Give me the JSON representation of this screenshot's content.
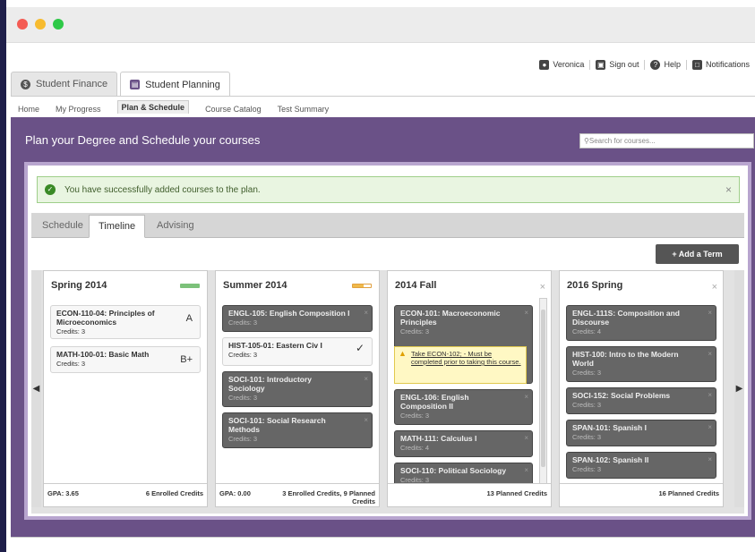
{
  "user": {
    "name": "Veronica",
    "sign_out": "Sign out",
    "help": "Help",
    "notifications": "Notifications"
  },
  "app_tabs": [
    {
      "label": "Student Finance"
    },
    {
      "label": "Student Planning"
    }
  ],
  "subnav": [
    "Home",
    "My Progress",
    "Plan & Schedule",
    "Course Catalog",
    "Test Summary"
  ],
  "header": {
    "title": "Plan your Degree and Schedule your courses",
    "search_placeholder": "Search for courses..."
  },
  "alert": {
    "message": "You have successfully added courses to the plan.",
    "close": "×"
  },
  "view_tabs": [
    "Schedule",
    "Timeline",
    "Advising"
  ],
  "add_term": "+ Add a Term",
  "nav": {
    "prev": "◀",
    "next": "▶"
  },
  "terms": [
    {
      "title": "Spring 2014",
      "courses": [
        {
          "name": "ECON-110-04: Principles of Microeconomics",
          "credits": "Credits: 3",
          "grade": "A"
        },
        {
          "name": "MATH-100-01: Basic Math",
          "credits": "Credits: 3",
          "grade": "B+"
        }
      ],
      "footer_left": "GPA: 3.65",
      "footer_right": "6 Enrolled Credits"
    },
    {
      "title": "Summer 2014",
      "courses": [
        {
          "name": "ENGL-105: English Composition I",
          "credits": "Credits: 3"
        },
        {
          "name": "HIST-105-01: Eastern Civ I",
          "credits": "Credits: 3",
          "mark": "✓"
        },
        {
          "name": "SOCI-101: Introductory Sociology",
          "credits": "Credits: 3"
        },
        {
          "name": "SOCI-101: Social Research Methods",
          "credits": "Credits: 3"
        }
      ],
      "footer_left": "GPA: 0.00",
      "footer_right": "3 Enrolled Credits, 9 Planned Credits"
    },
    {
      "title": "2014 Fall",
      "courses": [
        {
          "name": "ECON-101: Macroeconomic Principles",
          "credits": "Credits: 3"
        },
        {
          "name": "ENGL-106: English Composition II",
          "credits": "Credits: 3"
        },
        {
          "name": "MATH-111: Calculus I",
          "credits": "Credits: 4"
        },
        {
          "name": "SOCI-110: Political Sociology",
          "credits": "Credits: 3"
        }
      ],
      "warning": "Take ECON-102; - Must be completed prior to taking this course.",
      "footer_left": "",
      "footer_right": "13 Planned Credits"
    },
    {
      "title": "2016 Spring",
      "courses": [
        {
          "name": "ENGL-111S: Composition and Discourse",
          "credits": "Credits: 4"
        },
        {
          "name": "HIST-100: Intro to the Modern World",
          "credits": "Credits: 3"
        },
        {
          "name": "SOCI-152: Social Problems",
          "credits": "Credits: 3"
        },
        {
          "name": "SPAN-101: Spanish I",
          "credits": "Credits: 3"
        },
        {
          "name": "SPAN-102: Spanish II",
          "credits": "Credits: 3"
        }
      ],
      "footer_left": "",
      "footer_right": "16 Planned Credits"
    }
  ],
  "colors": {
    "brand_purple": "#6a5187",
    "planned_course": "#666666",
    "success": "#3a8a26"
  }
}
